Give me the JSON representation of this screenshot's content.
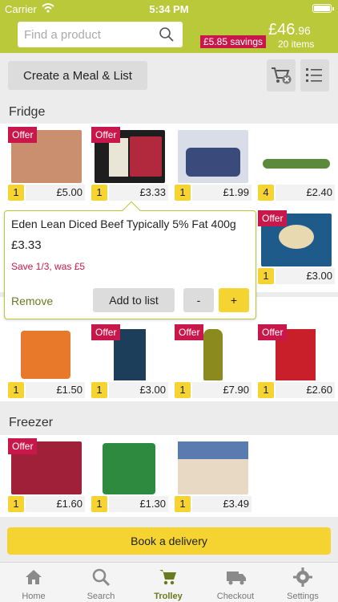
{
  "status_bar": {
    "carrier": "Carrier",
    "time": "5:34 PM"
  },
  "header": {
    "search_placeholder": "Find a product",
    "savings": "£5.85 savings",
    "total_main": "£46",
    "total_cents": ".96",
    "items": "20 items"
  },
  "actions": {
    "create_label": "Create a Meal & List",
    "clear_icon": "trolley-clear-icon",
    "list_icon": "list-icon"
  },
  "sections": {
    "fridge": "Fridge",
    "freezer": "Freezer"
  },
  "fridge_row1": [
    {
      "qty": "1",
      "price": "£5.00",
      "offer": "Offer",
      "img_color": "#c98f6e"
    },
    {
      "qty": "1",
      "price": "£3.33",
      "offer": "Offer",
      "img_color": "#b2283c"
    },
    {
      "qty": "1",
      "price": "£1.99",
      "offer": "",
      "img_color": "#3a4a7a"
    },
    {
      "qty": "4",
      "price": "£2.40",
      "offer": "",
      "img_color": "#5b8a3a"
    }
  ],
  "fridge_row2_last": {
    "qty": "1",
    "price": "£3.00",
    "offer": "Offer",
    "img_color": "#1f5b8a"
  },
  "fridge_row3": [
    {
      "qty": "1",
      "price": "£1.50",
      "offer": "",
      "img_color": "#e8792b"
    },
    {
      "qty": "1",
      "price": "£3.00",
      "offer": "Offer",
      "img_color": "#1d3e5b"
    },
    {
      "qty": "1",
      "price": "£7.90",
      "offer": "Offer",
      "img_color": "#8a8a1e"
    },
    {
      "qty": "1",
      "price": "£2.60",
      "offer": "Offer",
      "img_color": "#c81f2b"
    }
  ],
  "freezer_row": [
    {
      "qty": "1",
      "price": "£1.60",
      "offer": "Offer",
      "img_color": "#a0203a"
    },
    {
      "qty": "1",
      "price": "£1.30",
      "offer": "",
      "img_color": "#2e8a3e"
    },
    {
      "qty": "1",
      "price": "£3.49",
      "offer": "",
      "img_color": "#e7d9c4"
    }
  ],
  "popup": {
    "name": "Eden Lean Diced Beef Typically 5% Fat  400g",
    "price": "£3.33",
    "save": "Save 1/3, was £5",
    "remove": "Remove",
    "add": "Add to list",
    "minus": "-",
    "plus": "+"
  },
  "book_label": "Book a delivery",
  "tabs": [
    {
      "label": "Home",
      "icon": "home-icon"
    },
    {
      "label": "Search",
      "icon": "search-icon"
    },
    {
      "label": "Trolley",
      "icon": "trolley-icon"
    },
    {
      "label": "Checkout",
      "icon": "delivery-van-icon"
    },
    {
      "label": "Settings",
      "icon": "gear-icon"
    }
  ],
  "colors": {
    "brand_green": "#b9c93a",
    "offer_red": "#c8174b",
    "accent_yellow": "#f5d330"
  }
}
